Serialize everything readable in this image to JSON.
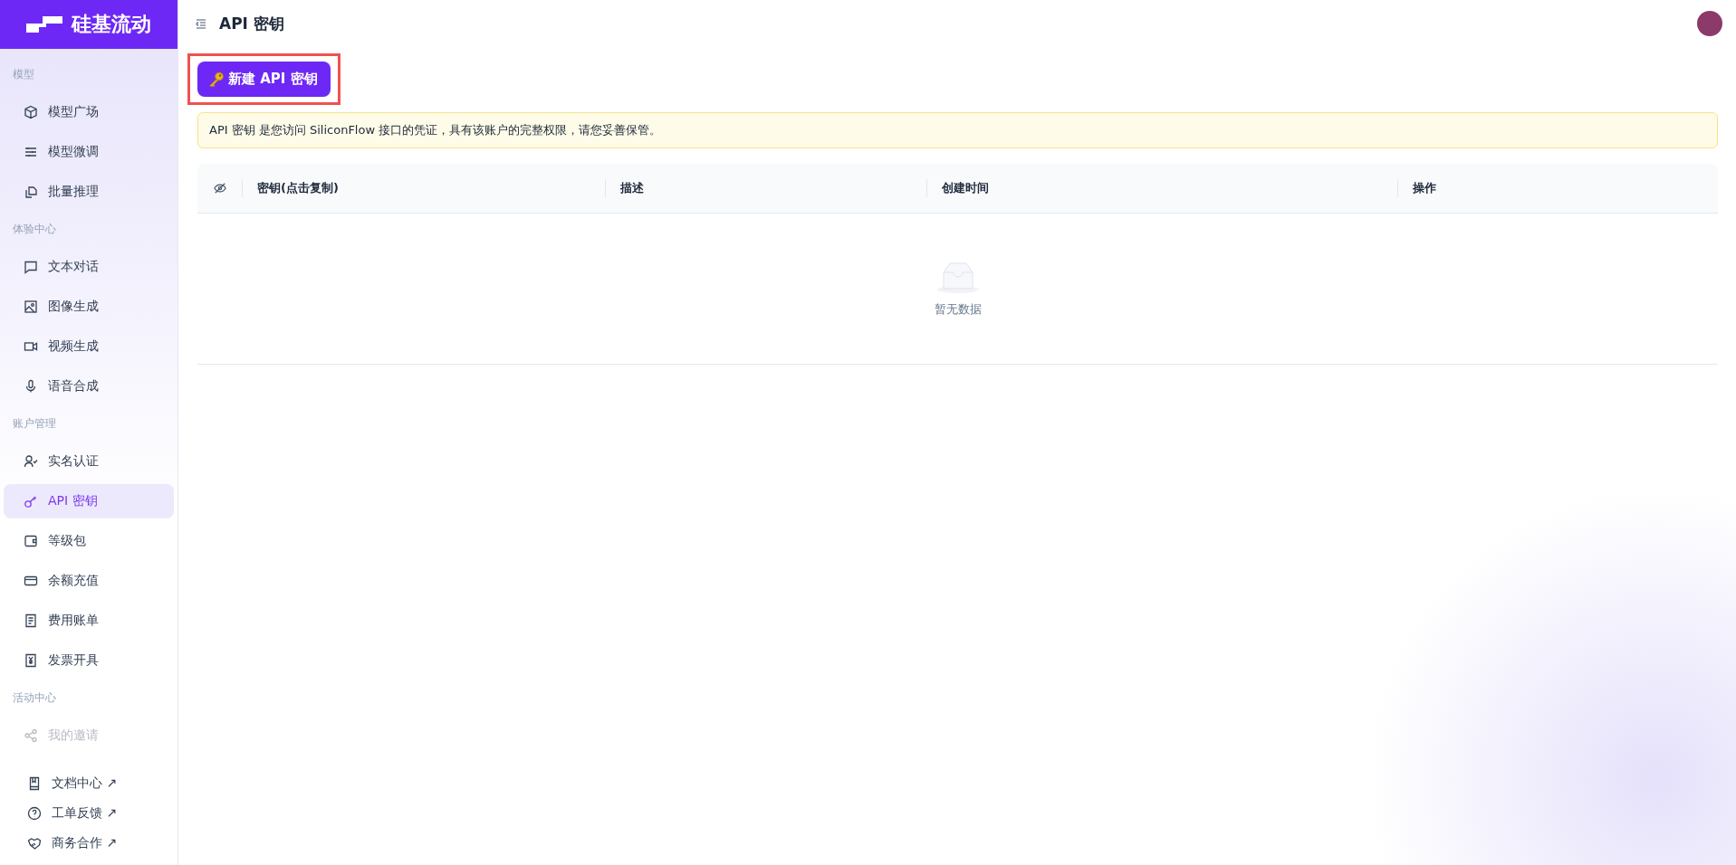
{
  "logo": {
    "text": "硅基流动"
  },
  "sidebar": {
    "sections": [
      {
        "title": "模型",
        "items": [
          {
            "label": "模型广场",
            "selected": false,
            "faded": false
          },
          {
            "label": "模型微调",
            "selected": false,
            "faded": false
          },
          {
            "label": "批量推理",
            "selected": false,
            "faded": false
          }
        ]
      },
      {
        "title": "体验中心",
        "items": [
          {
            "label": "文本对话",
            "selected": false,
            "faded": false
          },
          {
            "label": "图像生成",
            "selected": false,
            "faded": false
          },
          {
            "label": "视频生成",
            "selected": false,
            "faded": false
          },
          {
            "label": "语音合成",
            "selected": false,
            "faded": false
          }
        ]
      },
      {
        "title": "账户管理",
        "items": [
          {
            "label": "实名认证",
            "selected": false,
            "faded": false
          },
          {
            "label": "API 密钥",
            "selected": true,
            "faded": false
          },
          {
            "label": "等级包",
            "selected": false,
            "faded": false
          },
          {
            "label": "余额充值",
            "selected": false,
            "faded": false
          },
          {
            "label": "费用账单",
            "selected": false,
            "faded": false
          },
          {
            "label": "发票开具",
            "selected": false,
            "faded": false
          }
        ]
      },
      {
        "title": "活动中心",
        "items": [
          {
            "label": "我的邀请",
            "selected": false,
            "faded": true
          }
        ]
      }
    ],
    "links": [
      {
        "label": "文档中心 ↗"
      },
      {
        "label": "工单反馈 ↗"
      },
      {
        "label": "商务合作 ↗"
      }
    ]
  },
  "header": {
    "title": "API 密钥"
  },
  "create_button": {
    "label": "新建 API 密钥",
    "highlighted": true
  },
  "notice": "API 密钥 是您访问 SiliconFlow 接口的凭证，具有该账户的完整权限，请您妥善保管。",
  "table": {
    "columns": [
      "密钥(点击复制)",
      "描述",
      "创建时间",
      "操作"
    ],
    "empty_text": "暂无数据"
  }
}
